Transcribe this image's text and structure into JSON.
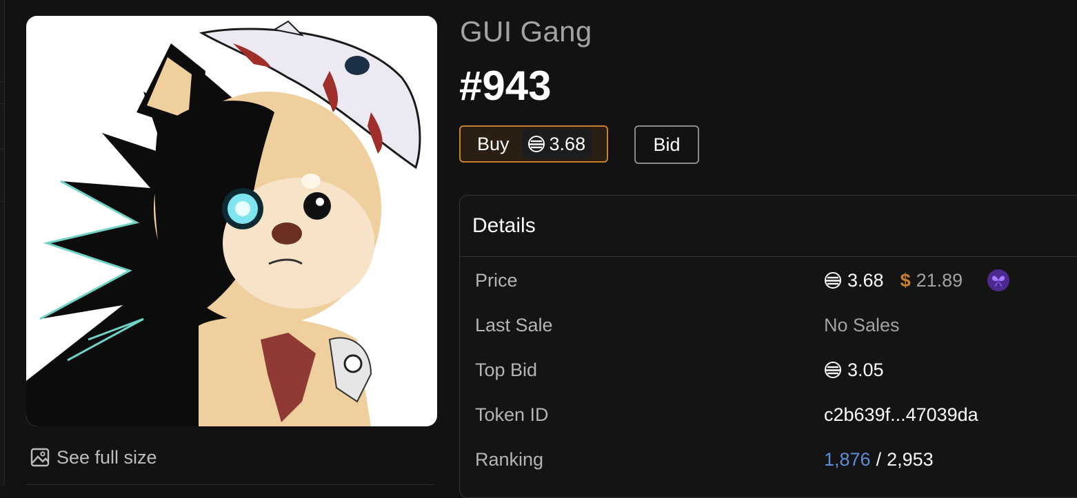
{
  "collection": {
    "name": "GUI Gang"
  },
  "token": {
    "title": "#943"
  },
  "actions": {
    "buy_label": "Buy",
    "buy_price": "3.68",
    "bid_label": "Bid"
  },
  "image": {
    "see_full_size_label": "See full size"
  },
  "details": {
    "header": "Details",
    "rows": {
      "price": {
        "label": "Price",
        "value": "3.68",
        "usd_symbol": "$",
        "usd_value": "21.89"
      },
      "last_sale": {
        "label": "Last Sale",
        "value": "No Sales"
      },
      "top_bid": {
        "label": "Top Bid",
        "value": "3.05"
      },
      "token_id": {
        "label": "Token ID",
        "value": "c2b639f...47039da"
      },
      "ranking": {
        "label": "Ranking",
        "rank": "1,876",
        "separator": "/",
        "total": "2,953"
      }
    }
  },
  "colors": {
    "background": "#121212",
    "buy_border": "#c9812c",
    "usd_color": "#c9812c",
    "link": "#5b8fd6"
  },
  "icons": [
    "sui-coin-icon",
    "image-icon",
    "butterfly-icon"
  ]
}
